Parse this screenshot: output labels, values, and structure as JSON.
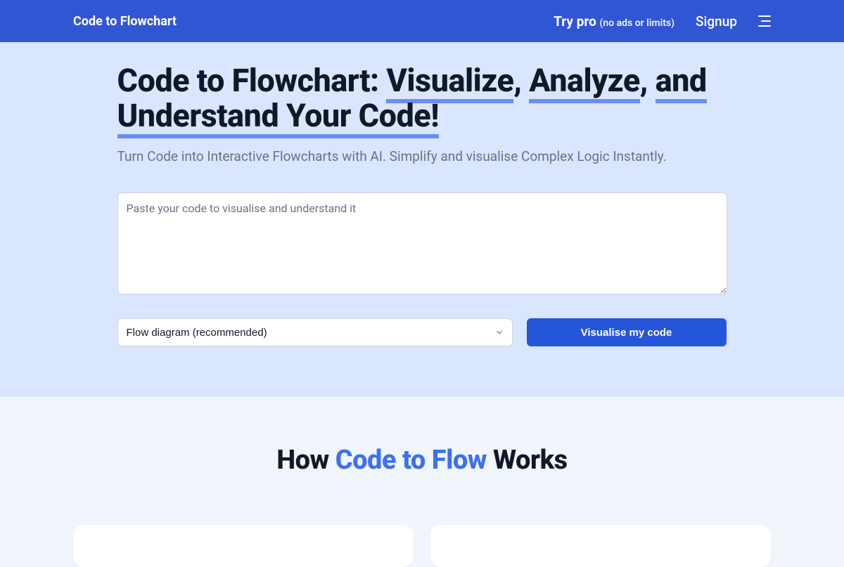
{
  "header": {
    "logo": "Code to Flowchart",
    "try_pro": "Try pro",
    "try_pro_sub": "(no ads or limits)",
    "signup": "Signup"
  },
  "hero": {
    "heading_prefix": "Code to Flowchart: ",
    "heading_u1": "Visualize",
    "heading_mid1": ", ",
    "heading_u2": "Analyze",
    "heading_mid2": ", ",
    "heading_u3": "and Understand Your Code!",
    "subheading": "Turn Code into Interactive Flowcharts with AI. Simplify and visualise Complex Logic Instantly.",
    "placeholder": "Paste your code to visualise and understand it",
    "select_value": "Flow diagram (recommended)",
    "button_label": "Visualise my code"
  },
  "how": {
    "prefix": "How ",
    "accent": "Code to Flow",
    "suffix": " Works"
  }
}
